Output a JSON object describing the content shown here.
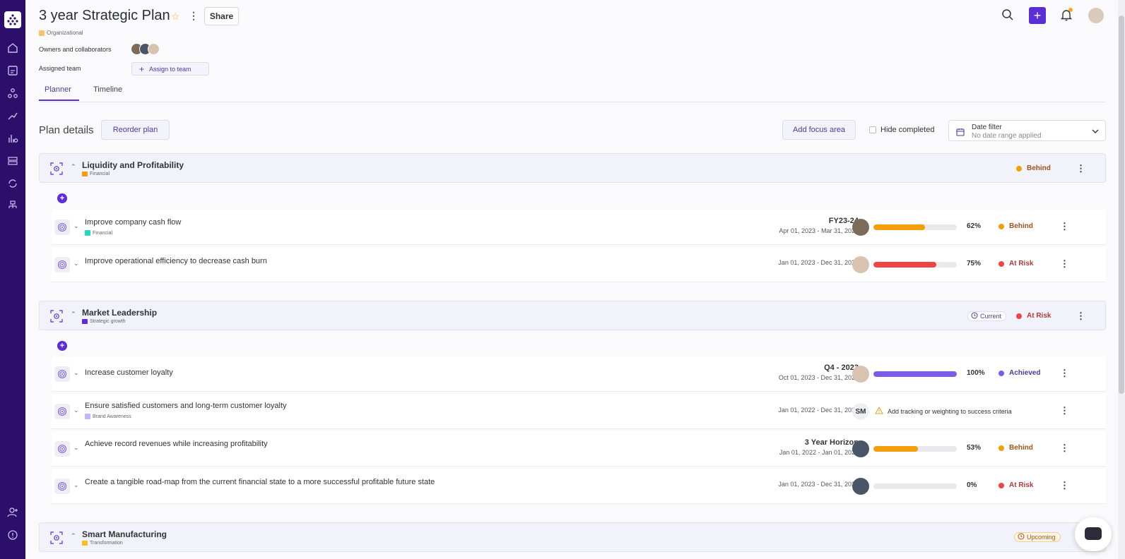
{
  "header": {
    "title": "3 year Strategic Plan",
    "share_label": "Share",
    "org_tag": "Organizational",
    "owners_label": "Owners and collaborators",
    "team_label": "Assigned team",
    "assign_label": "Assign to team"
  },
  "tabs": [
    {
      "label": "Planner",
      "active": true
    },
    {
      "label": "Timeline",
      "active": false
    }
  ],
  "toolbar": {
    "plan_details": "Plan details",
    "reorder_label": "Reorder plan",
    "add_focus_label": "Add focus area",
    "hide_completed": "Hide completed",
    "date_filter_title": "Date filter",
    "date_filter_value": "No date range applied"
  },
  "colors": {
    "accent": "#5b2fd6",
    "sidebar": "#2c0f6b",
    "behind": "#f59e0b",
    "at_risk": "#ef4444",
    "achieved": "#7c5ce6"
  },
  "focus_areas": [
    {
      "name": "Liquidity and Profitability",
      "tag": "Financial",
      "tag_color": "#f59e0b",
      "status": "Behind",
      "objectives": [
        {
          "title": "Improve company cash flow",
          "tag": "Financial",
          "tag_color": "#2dd4bf",
          "period": "FY23-24",
          "dates": "Apr 01, 2023 - Mar 31, 2024",
          "progress": "62%",
          "progress_value": 62,
          "status": "Behind"
        },
        {
          "title": "Improve operational efficiency to decrease cash burn",
          "tag": "",
          "period": "",
          "dates": "Jan 01, 2023 - Dec 31, 2024",
          "progress": "75%",
          "progress_value": 75,
          "status": "At Risk"
        }
      ]
    },
    {
      "name": "Market Leadership",
      "tag": "Strategic growth",
      "tag_color": "#5b2fd6",
      "badge": "Current",
      "status": "At Risk",
      "objectives": [
        {
          "title": "Increase customer loyalty",
          "tag": "",
          "period": "Q4 - 2023",
          "dates": "Oct 01, 2023 - Dec 31, 2023",
          "progress": "100%",
          "progress_value": 100,
          "status": "Achieved"
        },
        {
          "title": "Ensure satisfied customers and long-term customer loyalty",
          "tag": "Brand Awareness",
          "tag_color": "#c4b5fd",
          "period": "",
          "dates": "Jan 01, 2022 - Dec 31, 2024",
          "owner_initials": "SM",
          "warning": "Add tracking or weighting to success criteria"
        },
        {
          "title": "Achieve record revenues while increasing profitability",
          "tag": "",
          "period": "3 Year Horizon",
          "dates": "Jan 01, 2022 - Jan 01, 2026",
          "progress": "53%",
          "progress_value": 53,
          "status": "Behind"
        },
        {
          "title": "Create a tangible road-map from the current financial state to a more successful profitable future state",
          "tag": "",
          "period": "",
          "dates": "Jan 01, 2023 - Dec 31, 2025",
          "progress": "0%",
          "progress_value": 0,
          "status": "At Risk"
        }
      ]
    },
    {
      "name": "Smart Manufacturing",
      "tag": "Transformation",
      "tag_color": "#fbbf24",
      "badge": "Upcoming"
    }
  ]
}
